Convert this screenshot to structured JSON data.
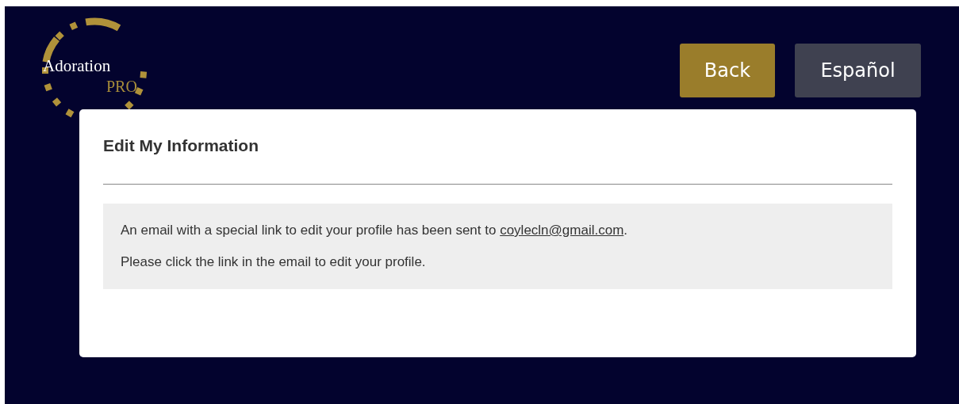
{
  "logo": {
    "name": "Adoration",
    "suffix": "PRO"
  },
  "buttons": [
    {
      "label": "Back",
      "kind": "primary"
    },
    {
      "label": "Español",
      "kind": "secondary"
    }
  ],
  "card": {
    "title": "Edit My Information",
    "notice": {
      "message_before": "An email with a special link to edit your profile has been sent to ",
      "link": "coylecln@gmail.com",
      "message_after": ".",
      "instruction": "Please click the link in the email to edit your profile."
    }
  }
}
